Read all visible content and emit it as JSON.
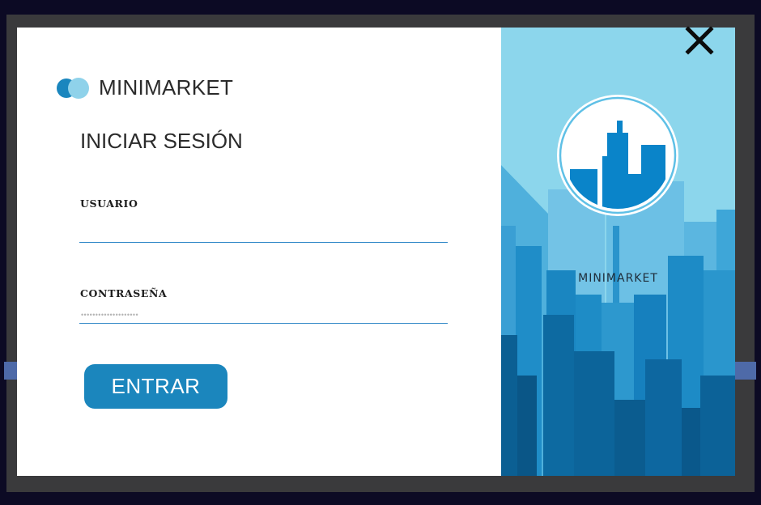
{
  "brand": {
    "name": "MINIMARKET",
    "logo_icon": "two-circles-logo-icon",
    "logo_colors": [
      "#1a86be",
      "#8fd2ea"
    ]
  },
  "form": {
    "title": "INICIAR SESIÓN",
    "username": {
      "label": "USUARIO",
      "value": ""
    },
    "password": {
      "label": "CONTRASEÑA",
      "placeholder": "••••••••••••••••••••"
    },
    "submit_label": "ENTRAR"
  },
  "side_panel": {
    "brand_text": "MINIMARKET",
    "emblem_icon": "city-skyline-emblem-icon"
  },
  "window": {
    "close_icon": "close-icon"
  },
  "colors": {
    "accent": "#1b86bd",
    "panel_bg": "#8cd6ec",
    "input_underline": "#2f87c7"
  }
}
